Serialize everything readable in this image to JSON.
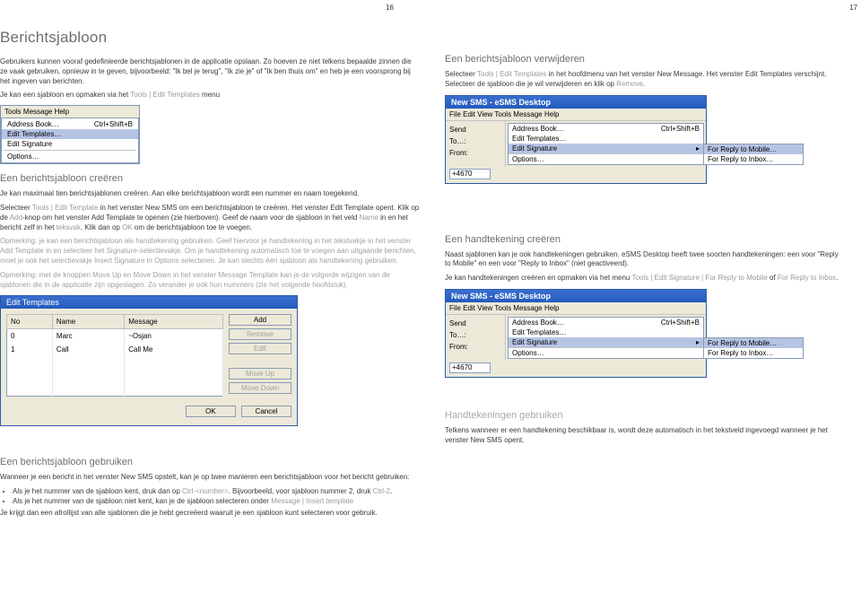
{
  "page_numbers": {
    "left": "16",
    "right": "17"
  },
  "left": {
    "h1": "Berichtsjabloon",
    "intro": "Gebruikers kunnen vooraf gedefinieerde berichtsjablonen in de applicatie opslaan. Zo hoeven ze niet telkens bepaalde zinnen die ze vaak gebruiken, opnieuw in te geven, bijvoorbeeld: \"Ik bel je terug\", \"Ik zie je\" of \"Ik ben thuis om\" en heb je een voorsprong bij het ingeven van berichten.",
    "intro2_pre": "Je kan een sjabloon en opmaken via het ",
    "intro2_link": "Tools | Edit Templates",
    "intro2_post": " menu",
    "menubar": "Tools   Message   Help",
    "menu": {
      "address": "Address Book…",
      "address_sc": "Ctrl+Shift+B",
      "edit_templates": "Edit Templates…",
      "edit_signature": "Edit Signature",
      "options": "Options…"
    },
    "h2_create": "Een berichtsjabloon creëren",
    "create_p1": "Je kan maximaal tien berichtsjablonen creëren. Aan elke berichtsjabloon wordt een nummer en naam toegekend.",
    "create_p2a": "Selecteer ",
    "create_p2_link1": "Tools | Edit Template",
    "create_p2b": " in het venster New SMS om een berichtsjabloon te creëren. Het venster Edit Template opent. Klik op de ",
    "create_p2_link2": "Add",
    "create_p2c": "-knop om het venster Add Template te openen (zie hierboven). Geef de naam voor de sjabloon in het veld ",
    "create_p2_link3": "Name",
    "create_p2d": " in en het bericht zelf in het ",
    "create_p2_link4": "teksvak",
    "create_p2e": ". Klik dan op ",
    "create_p2_link5": "OK",
    "create_p2f": " om de berichtsjabloon toe te voegen.",
    "note1": "Opmerking: je kan een berichtsjabloon als handtekening gebruiken. Geef hiervoor je handtekening in het tekstvakje in het venster Add Template in en selecteer het Signature-selectievakje. Om je handtekening automatisch toe te voegen aan uitgaande berichten, moet je ook het selectievakje Insert Signature in Options selecteren. Je kan slechts één sjabloon als handtekening gebruiken.",
    "note2": "Opmerking: met de knoppen Move Up en Move Down in het venster Message Template kan je de volgorde wijzigen van de sjablonen die in de applicatie zijn opgeslagen. Zo verander je ook hun nummers (zie het volgende hoofdstuk).",
    "dlg": {
      "title": "Edit Templates",
      "cols": {
        "no": "No",
        "name": "Name",
        "msg": "Message"
      },
      "rows": [
        {
          "no": "0",
          "name": "Marc",
          "msg": "~Osjan"
        },
        {
          "no": "1",
          "name": "Call",
          "msg": "Call Me"
        }
      ],
      "btns": {
        "add": "Add",
        "remove": "Remove",
        "edit": "Edit",
        "up": "Move Up",
        "down": "Move Down",
        "ok": "OK",
        "cancel": "Cancel"
      }
    },
    "h2_use": "Een berichtsjabloon gebruiken",
    "use_p1": "Wanneer je een bericht in het venster New SMS opstelt, kan je op twee manieren een berichtsjabloon voor het bericht gebruiken:",
    "use_b1a": "Als je het nummer van de sjabloon kent, druk dan op ",
    "use_b1_k": "Ctrl-<number>",
    "use_b1b": ". Bijvoorbeeld, voor sjabloon nummer 2, druk ",
    "use_b1_k2": "Ctrl-2",
    "use_b1c": ".",
    "use_b2a": "Als je het nummer van de sjabloon niet kent, kan je de sjabloon selecteren onder ",
    "use_b2_link": "Message | Insert template",
    "use_p2": "Je krijgt dan een afrollijst van alle sjablonen die je hebt gecreëerd waaruit je een sjabloon kunt selecteren voor gebruik."
  },
  "right": {
    "h2_del": "Een berichtsjabloon verwijderen",
    "del_p1a": "Selecteer ",
    "del_link1": "Tools | Edit Templates",
    "del_p1b": " in het hoofdmenu van het venster New Message. Het venster Edit Templates verschijnt. Selecteer de sjabloon die je wil verwijderen en klik op ",
    "del_link2": "Remove",
    "del_p1c": ".",
    "win": {
      "title": "New SMS - eSMS Desktop",
      "menubar": "File   Edit   View   Tools   Message   Help",
      "left_rows": {
        "send": "Send",
        "to": "To…:",
        "from": "From:"
      },
      "from_value": "+4670",
      "tools": {
        "address": "Address Book…",
        "address_sc": "Ctrl+Shift+B",
        "edit_templates": "Edit Templates…",
        "edit_signature": "Edit Signature",
        "options": "Options…"
      },
      "sig_sub": {
        "rm": "For Reply to Mobile…",
        "ri": "For Reply to Inbox…"
      }
    },
    "h2_sig": "Een handtekening creëren",
    "sig_p1": "Naast sjablonen kan je ook handtekeningen gebruiken. eSMS Desktop heeft twee soorten handtekeningen: een voor \"Reply to Mobile\" en een voor \"Reply to Inbox\" (niet geactiveerd).",
    "sig_p2a": "Je kan handtekeningen creëren en opmaken via het menu ",
    "sig_link1": "Tools | Edit Signature | For Reply to Mobile",
    "sig_mid": " of ",
    "sig_link2": "For Reply to Inbox",
    "sig_p2b": ".",
    "h2_usesig": "Handtekeningen gebruiken",
    "usesig_p1": "Telkens wanneer er een handtekening beschikbaar is, wordt deze automatisch in het tekstveld ingevoegd wanneer je het venster New SMS opent."
  }
}
